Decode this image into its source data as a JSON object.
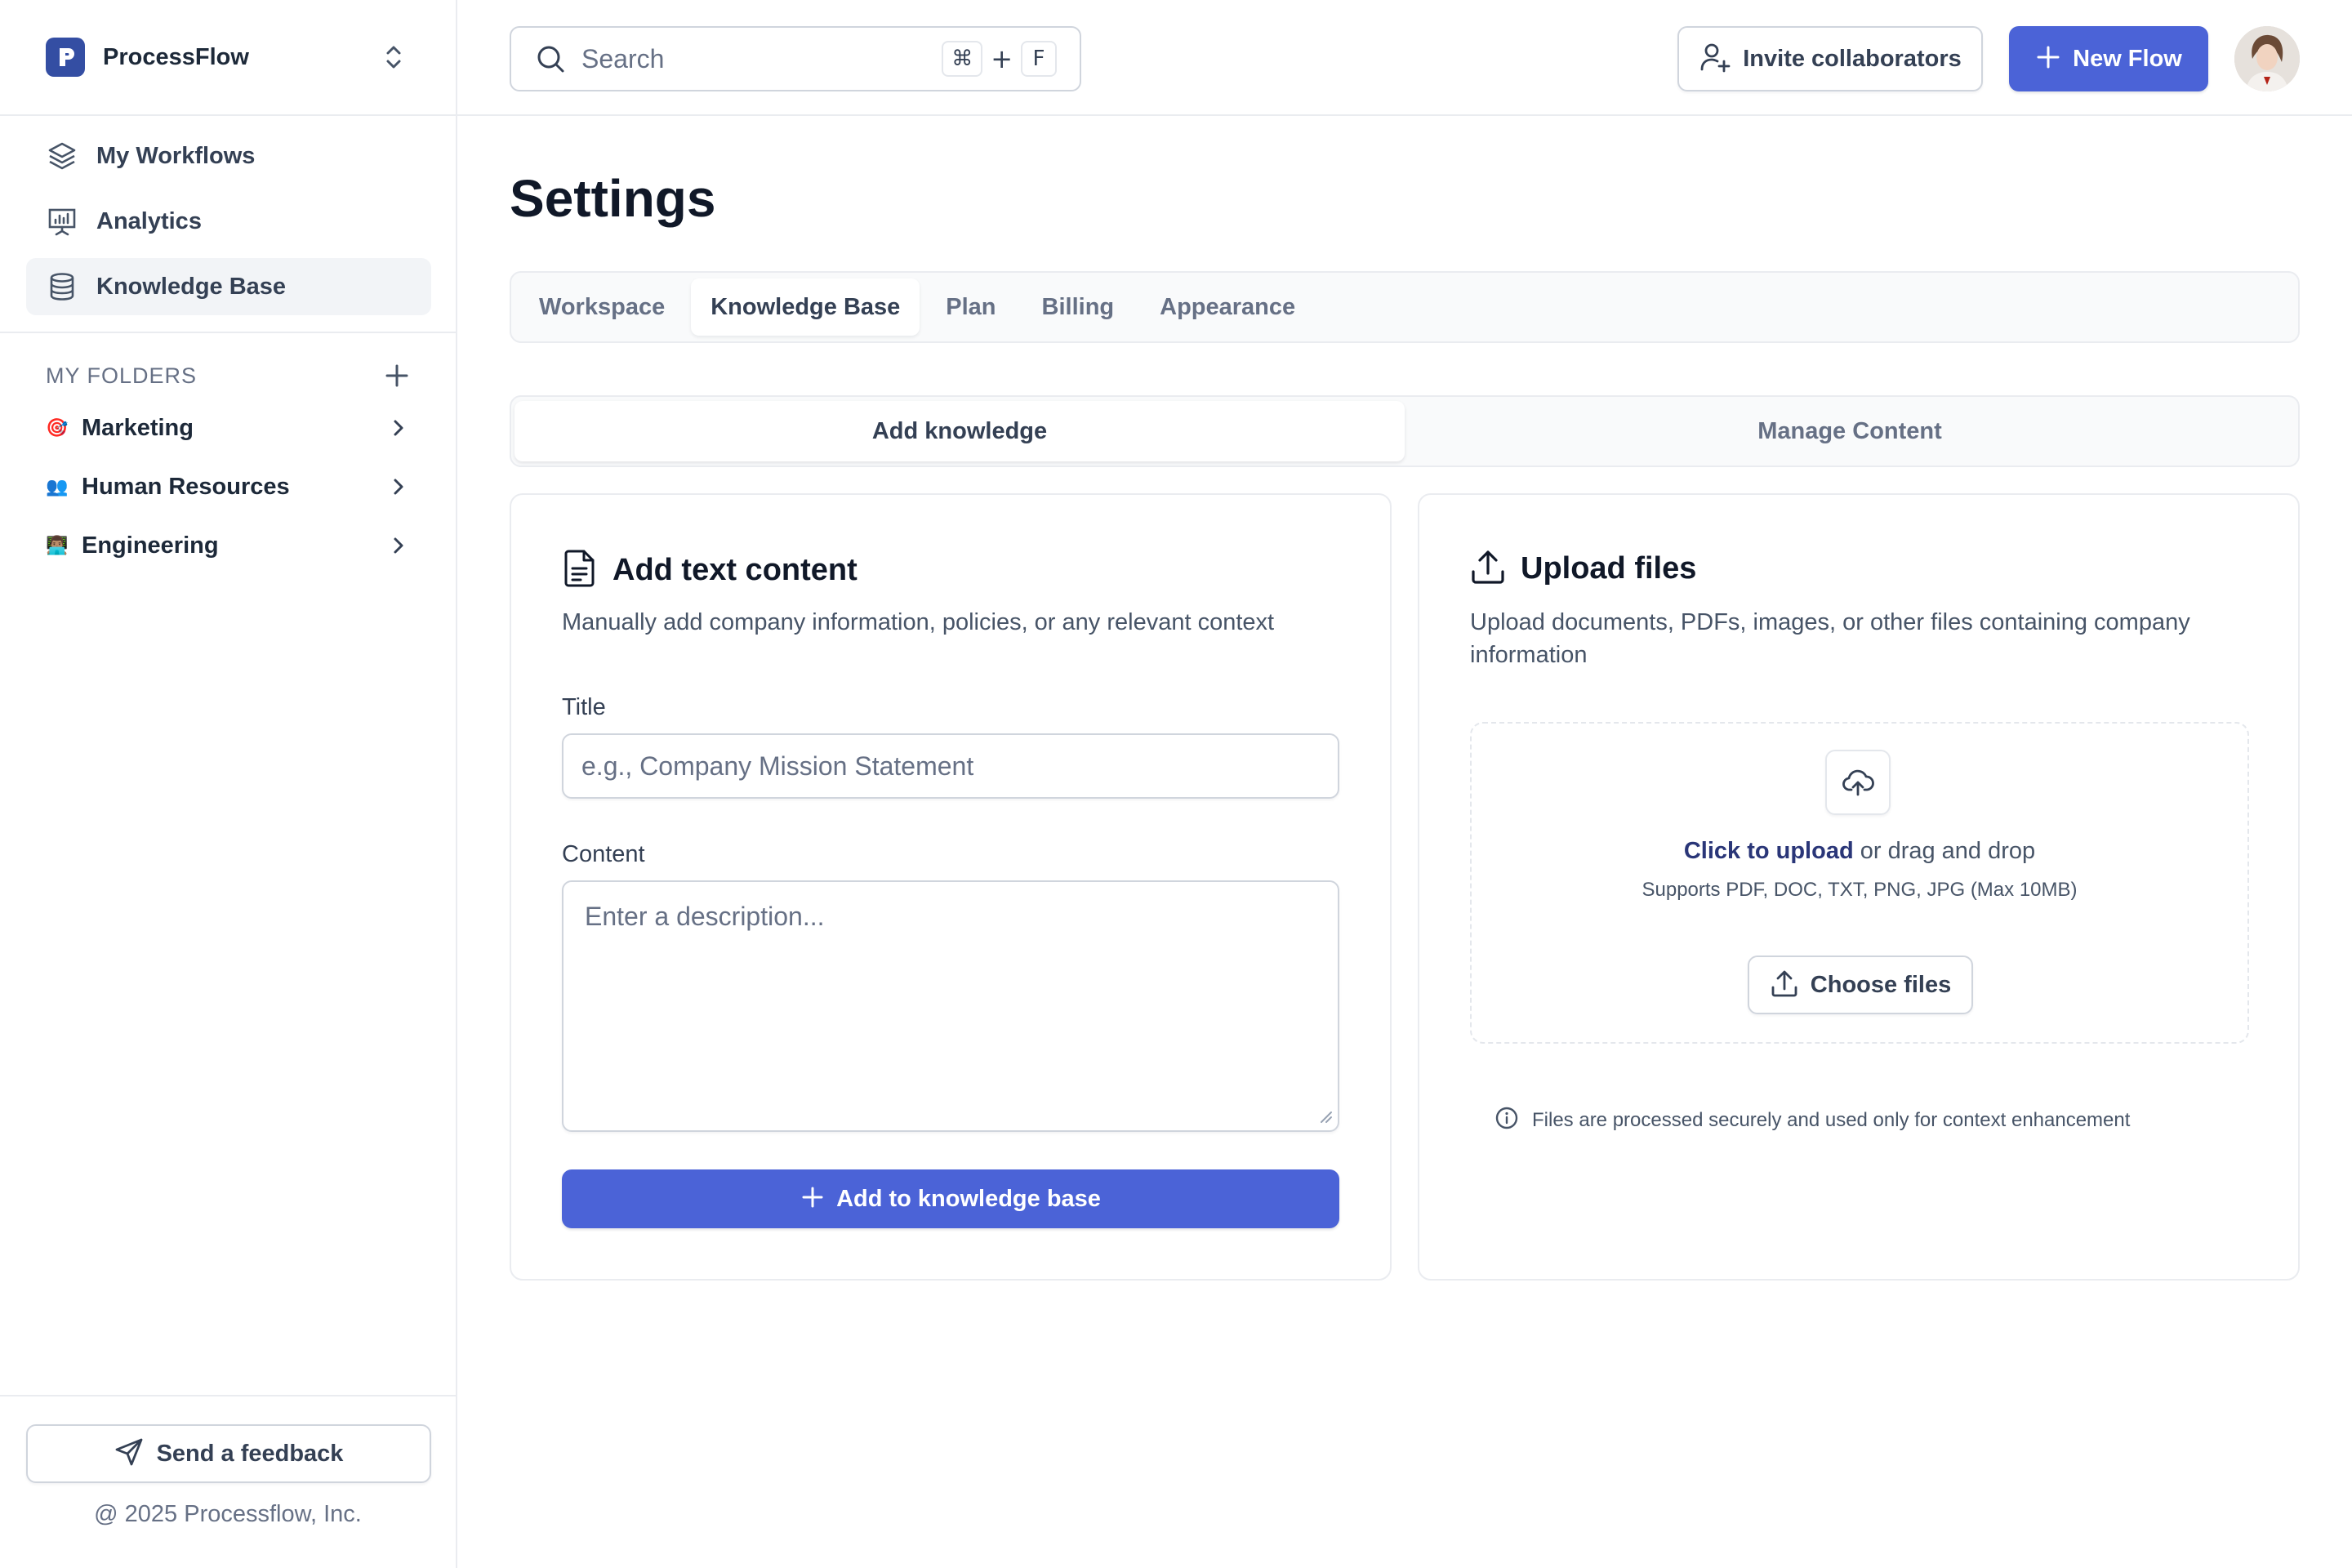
{
  "brand": {
    "name": "ProcessFlow"
  },
  "sidebar": {
    "nav": [
      {
        "label": "My Workflows",
        "icon": "layers-icon"
      },
      {
        "label": "Analytics",
        "icon": "presentation-chart-icon"
      },
      {
        "label": "Knowledge Base",
        "icon": "database-icon",
        "active": true
      }
    ],
    "folders_title": "MY FOLDERS",
    "folders": [
      {
        "emoji": "🎯",
        "label": "Marketing"
      },
      {
        "emoji": "👥",
        "label": "Human Resources"
      },
      {
        "emoji": "👨🏽‍💻",
        "label": "Engineering"
      }
    ],
    "feedback_label": "Send a feedback",
    "copyright": "@ 2025 Processflow, Inc."
  },
  "topbar": {
    "search_placeholder": "Search",
    "shortcut_key1": "⌘",
    "shortcut_plus": "+",
    "shortcut_key2": "F",
    "invite_label": "Invite collaborators",
    "new_flow_label": "New Flow"
  },
  "page": {
    "title": "Settings",
    "tabs": [
      "Workspace",
      "Knowledge Base",
      "Plan",
      "Billing",
      "Appearance"
    ],
    "active_tab": "Knowledge Base",
    "segments": [
      "Add knowledge",
      "Manage Content"
    ],
    "active_segment": "Add knowledge"
  },
  "text_card": {
    "title": "Add text content",
    "description": "Manually add company information, policies, or any relevant context",
    "title_label": "Title",
    "title_placeholder": "e.g., Company Mission Statement",
    "content_label": "Content",
    "content_placeholder": "Enter a description...",
    "submit_label": "Add to knowledge base"
  },
  "upload_card": {
    "title": "Upload files",
    "description": "Upload documents, PDFs, images, or other files containing company information",
    "click_to_upload": "Click to upload",
    "drag_text": " or drag and drop",
    "supports": "Supports PDF, DOC, TXT, PNG, JPG (Max 10MB)",
    "choose_label": "Choose files",
    "note": "Files are processed securely and used only for context enhancement"
  },
  "colors": {
    "primary": "#4b63d7",
    "brand_logo": "#344ea3",
    "link": "#2a3678",
    "active_bg": "#f2f4f7"
  }
}
